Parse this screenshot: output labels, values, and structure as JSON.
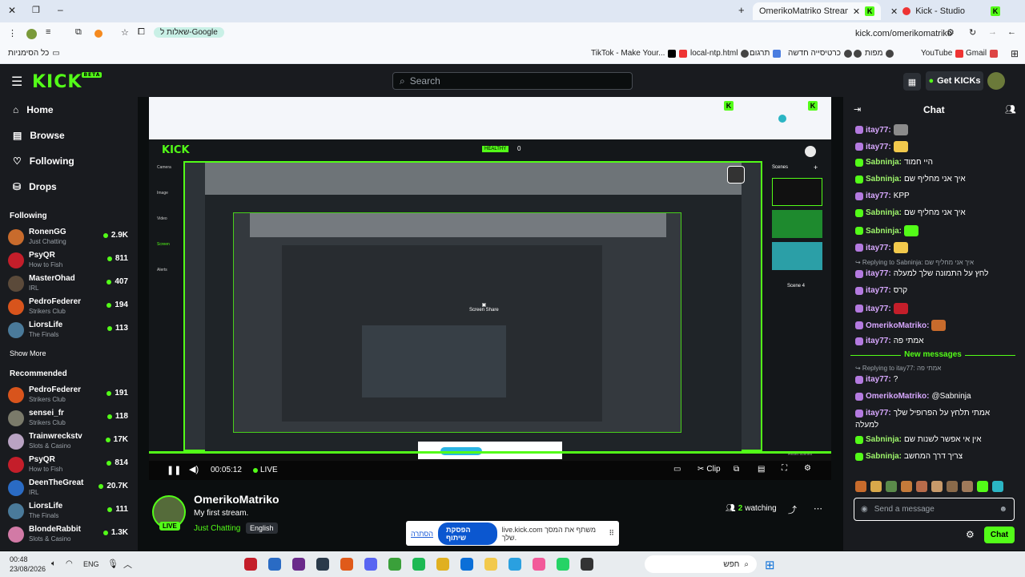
{
  "browser": {
    "tabs": [
      {
        "title": "OmerikoMatriko Stream - Watc"
      },
      {
        "title": "Kick - Studio"
      }
    ],
    "url": "kick.com/omerikomatriko",
    "lens_chip": "שאלות ל-Google",
    "bookmarks_all": "כל הסימניות",
    "bookmarks": [
      "Gmail",
      "YouTube",
      "מפות",
      "כרטיסייה חדשה",
      "תרגום",
      "local-ntp.html",
      "TikTok - Make Your..."
    ]
  },
  "header": {
    "search_placeholder": "Search",
    "get_kicks": "Get KICKs",
    "beta": "BETA"
  },
  "sidebar": {
    "nav": [
      {
        "label": "Home"
      },
      {
        "label": "Browse"
      },
      {
        "label": "Following"
      },
      {
        "label": "Drops"
      }
    ],
    "following_title": "Following",
    "following": [
      {
        "name": "RonenGG",
        "category": "Just Chatting",
        "viewers": "2.9K",
        "color": "#c86b2c"
      },
      {
        "name": "PsyQR",
        "category": "How to Fish",
        "viewers": "811",
        "color": "#c41e2a"
      },
      {
        "name": "MasterOhad",
        "category": "IRL",
        "viewers": "407",
        "color": "#5b4a3a"
      },
      {
        "name": "PedroFederer",
        "category": "Strikers Club",
        "viewers": "194",
        "color": "#d8541c"
      },
      {
        "name": "LiorsLife",
        "category": "The Finals",
        "viewers": "113",
        "color": "#4a7a9a"
      }
    ],
    "show_more": "Show More",
    "recommended_title": "Recommended",
    "recommended": [
      {
        "name": "PedroFederer",
        "category": "Strikers Club",
        "viewers": "191",
        "color": "#d8541c"
      },
      {
        "name": "sensei_fr",
        "category": "Strikers Club",
        "viewers": "118",
        "color": "#7a7a6a"
      },
      {
        "name": "Trainwreckstv",
        "category": "Slots & Casino",
        "viewers": "17K",
        "color": "#b9a3c3"
      },
      {
        "name": "PsyQR",
        "category": "How to Fish",
        "viewers": "814",
        "color": "#c41e2a"
      },
      {
        "name": "DeenTheGreat",
        "category": "IRL",
        "viewers": "20.7K",
        "color": "#2a6bc4"
      },
      {
        "name": "LiorsLife",
        "category": "The Finals",
        "viewers": "111",
        "color": "#4a7a9a"
      },
      {
        "name": "BlondeRabbit",
        "category": "Slots & Casino",
        "viewers": "1.3K",
        "color": "#d27aa6"
      }
    ]
  },
  "player": {
    "time": "00:05:12",
    "live": "LIVE",
    "clip": "Clip",
    "inner_health": "HEALTHY",
    "inner_count": "0",
    "scenes_label": "Scenes",
    "scene_name": "Scene 4",
    "screen_share": "Screen Share",
    "left_tools": [
      "Camera",
      "Image",
      "Video",
      "Screen",
      "Alerts"
    ],
    "reset_scenes": "Reset scenes"
  },
  "stream": {
    "channel": "OmerikoMatriko",
    "title": "My first stream.",
    "category": "Just Chatting",
    "language": "English",
    "watching_count": "2",
    "watching_label": "watching",
    "live_badge": "LIVE"
  },
  "chat": {
    "title": "Chat",
    "messages": [
      {
        "user": "itay77",
        "text": "",
        "color": "#b47ae0",
        "emote": "#8b8b8b"
      },
      {
        "user": "itay77",
        "text": "",
        "color": "#b47ae0",
        "emote": "#f2c94c"
      },
      {
        "user": "Sabninja",
        "text": "היי חמוד",
        "color": "#53fc18"
      },
      {
        "user": "Sabninja",
        "text": "איך אני מחליף שם",
        "color": "#53fc18"
      },
      {
        "user": "itay77",
        "text": "KPP",
        "color": "#b47ae0"
      },
      {
        "user": "Sabninja",
        "text": "איך אני מחליף שם",
        "color": "#53fc18"
      },
      {
        "user": "Sabninja",
        "text": "",
        "color": "#53fc18",
        "emote": "#53fc18"
      },
      {
        "user": "itay77",
        "text": "",
        "color": "#b47ae0",
        "emote": "#f2c94c"
      },
      {
        "reply": "Replying to Sabninja: איך אני מחליף שם"
      },
      {
        "user": "itay77",
        "text": "לחץ על התמונה שלך למעלה",
        "color": "#b47ae0"
      },
      {
        "user": "itay77",
        "text": "קרס",
        "color": "#b47ae0"
      },
      {
        "user": "itay77",
        "text": "",
        "color": "#b47ae0",
        "emote": "#c41e2a"
      },
      {
        "user": "OmerikoMatriko",
        "text": "",
        "color": "#b47ae0",
        "emote": "#c86b2c"
      },
      {
        "user": "itay77",
        "text": "אמתי פה",
        "color": "#b47ae0"
      }
    ],
    "new_messages": "New messages",
    "messages2": [
      {
        "reply": "Replying to itay77: אמתי פה"
      },
      {
        "user": "itay77",
        "text": "?",
        "color": "#b47ae0"
      },
      {
        "user": "OmerikoMatriko",
        "text": "@Sabninja",
        "color": "#b47ae0"
      },
      {
        "user": "itay77",
        "text": "אמתי תלחץ על הפרופיל שלך",
        "color": "#b47ae0",
        "cont": "למעלה"
      },
      {
        "user": "Sabninja",
        "text": "אין אי אפשר לשנות שם",
        "color": "#53fc18"
      },
      {
        "user": "Sabninja",
        "text": "צריך דרך המחשב",
        "color": "#53fc18"
      }
    ],
    "input_placeholder": "Send a message",
    "send_label": "Chat"
  },
  "share_bar": {
    "text": "live.kick.com משתף את המסך שלך.",
    "stop": "הפסקת שיתוף",
    "hide": "הסתרה"
  },
  "taskbar": {
    "time": "00:48",
    "date": "23/08/2026",
    "lang": "ENG",
    "search": "חפש"
  }
}
